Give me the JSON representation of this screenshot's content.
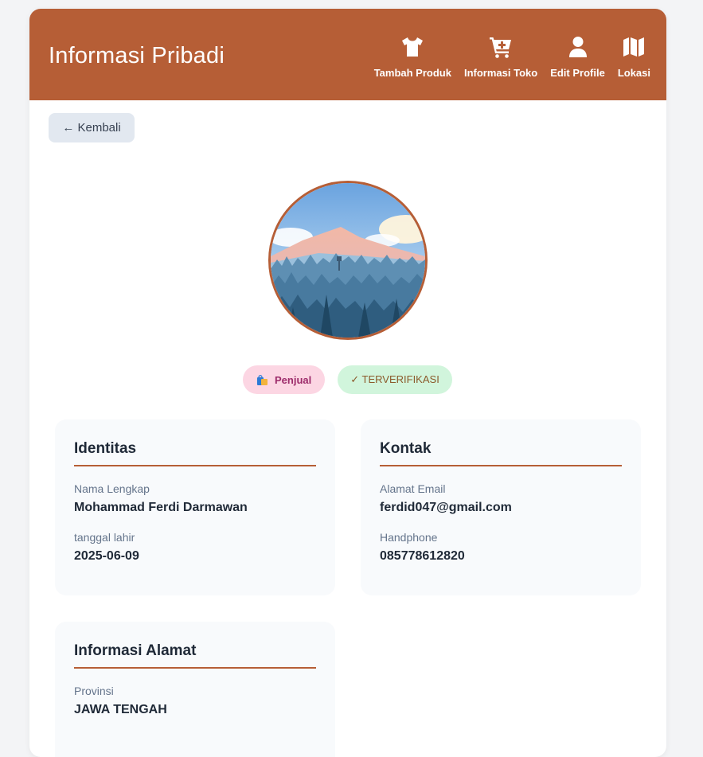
{
  "header": {
    "title": "Informasi Pribadi",
    "nav": [
      {
        "label": "Tambah Produk",
        "icon": "tshirt-icon"
      },
      {
        "label": "Informasi Toko",
        "icon": "cart-plus-icon"
      },
      {
        "label": "Edit Profile",
        "icon": "user-icon"
      },
      {
        "label": "Lokasi",
        "icon": "map-icon"
      }
    ],
    "color": "#b65e36"
  },
  "back_button": {
    "label": "← Kembali"
  },
  "badges": {
    "role": "Penjual",
    "role_icon": "shopping-bags-icon",
    "verified": "✓ TERVERIFIKASI"
  },
  "identitas": {
    "title": "Identitas",
    "fields": [
      {
        "label": "Nama Lengkap",
        "value": "Mohammad Ferdi Darmawan"
      },
      {
        "label": "tanggal lahir",
        "value": "2025-06-09"
      }
    ]
  },
  "kontak": {
    "title": "Kontak",
    "fields": [
      {
        "label": "Alamat Email",
        "value": "ferdid047@gmail.com"
      },
      {
        "label": "Handphone",
        "value": "085778612820"
      }
    ]
  },
  "alamat": {
    "title": "Informasi Alamat",
    "fields": [
      {
        "label": "Provinsi",
        "value": "JAWA TENGAH"
      }
    ]
  }
}
